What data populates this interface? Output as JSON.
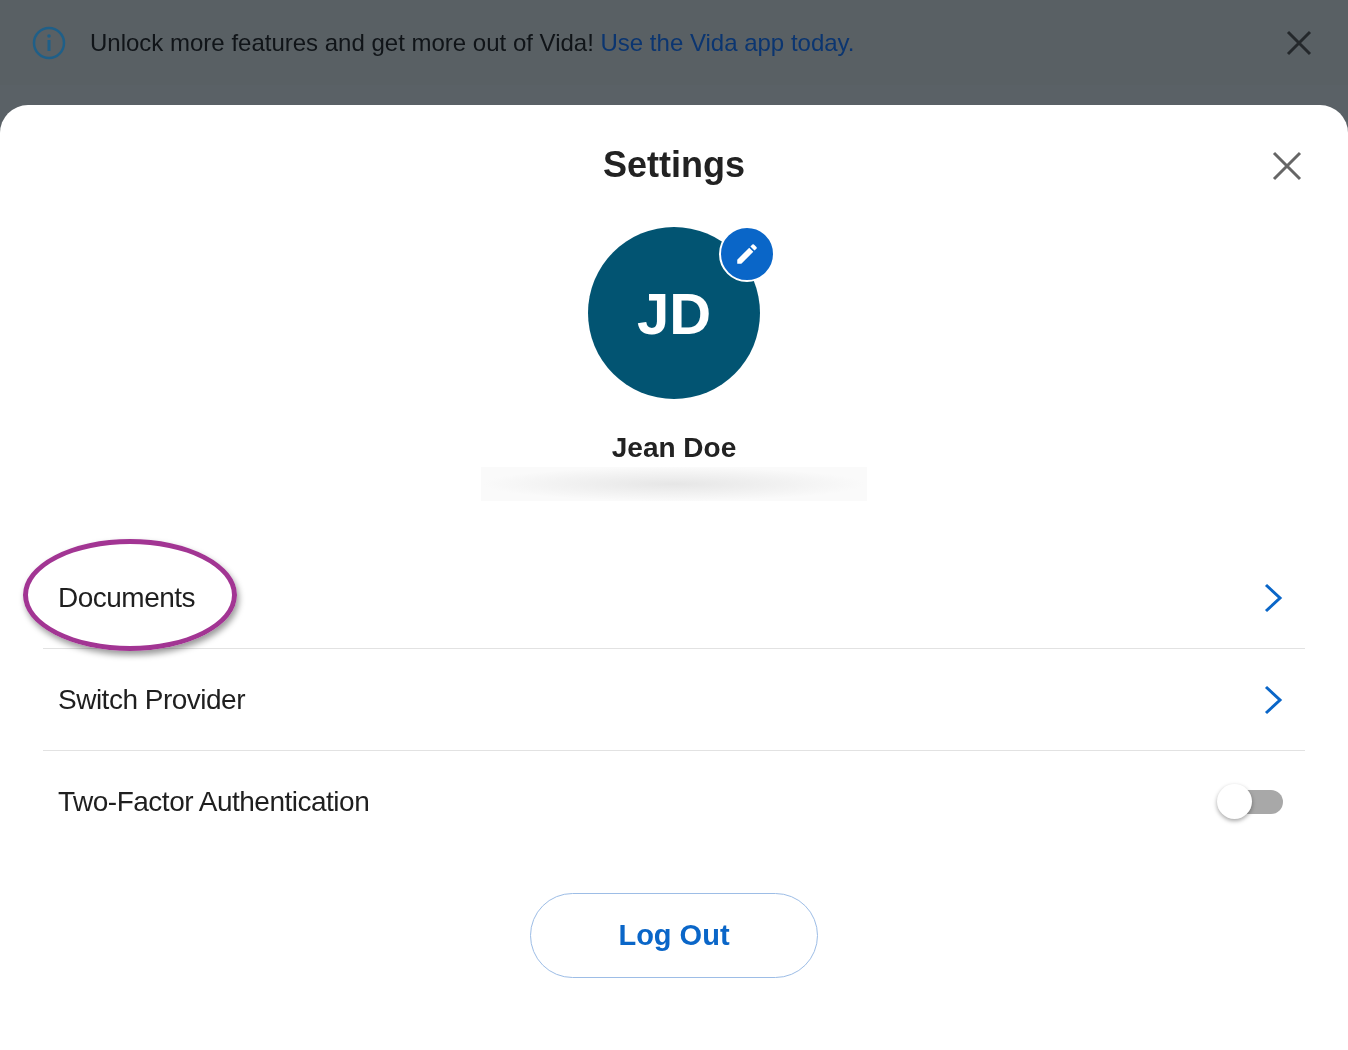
{
  "banner": {
    "message": "Unlock more features and get more out of Vida!",
    "link": "Use the Vida app today."
  },
  "dialog": {
    "title": "Settings",
    "avatar_initials": "JD",
    "user_name": "Jean Doe"
  },
  "items": [
    {
      "kind": "link",
      "label": "Documents",
      "circled": true
    },
    {
      "kind": "link",
      "label": "Switch Provider",
      "circled": false
    },
    {
      "kind": "toggle",
      "label": "Two-Factor Authentication",
      "on": false,
      "circled": false
    }
  ],
  "logout_button": "Log Out"
}
